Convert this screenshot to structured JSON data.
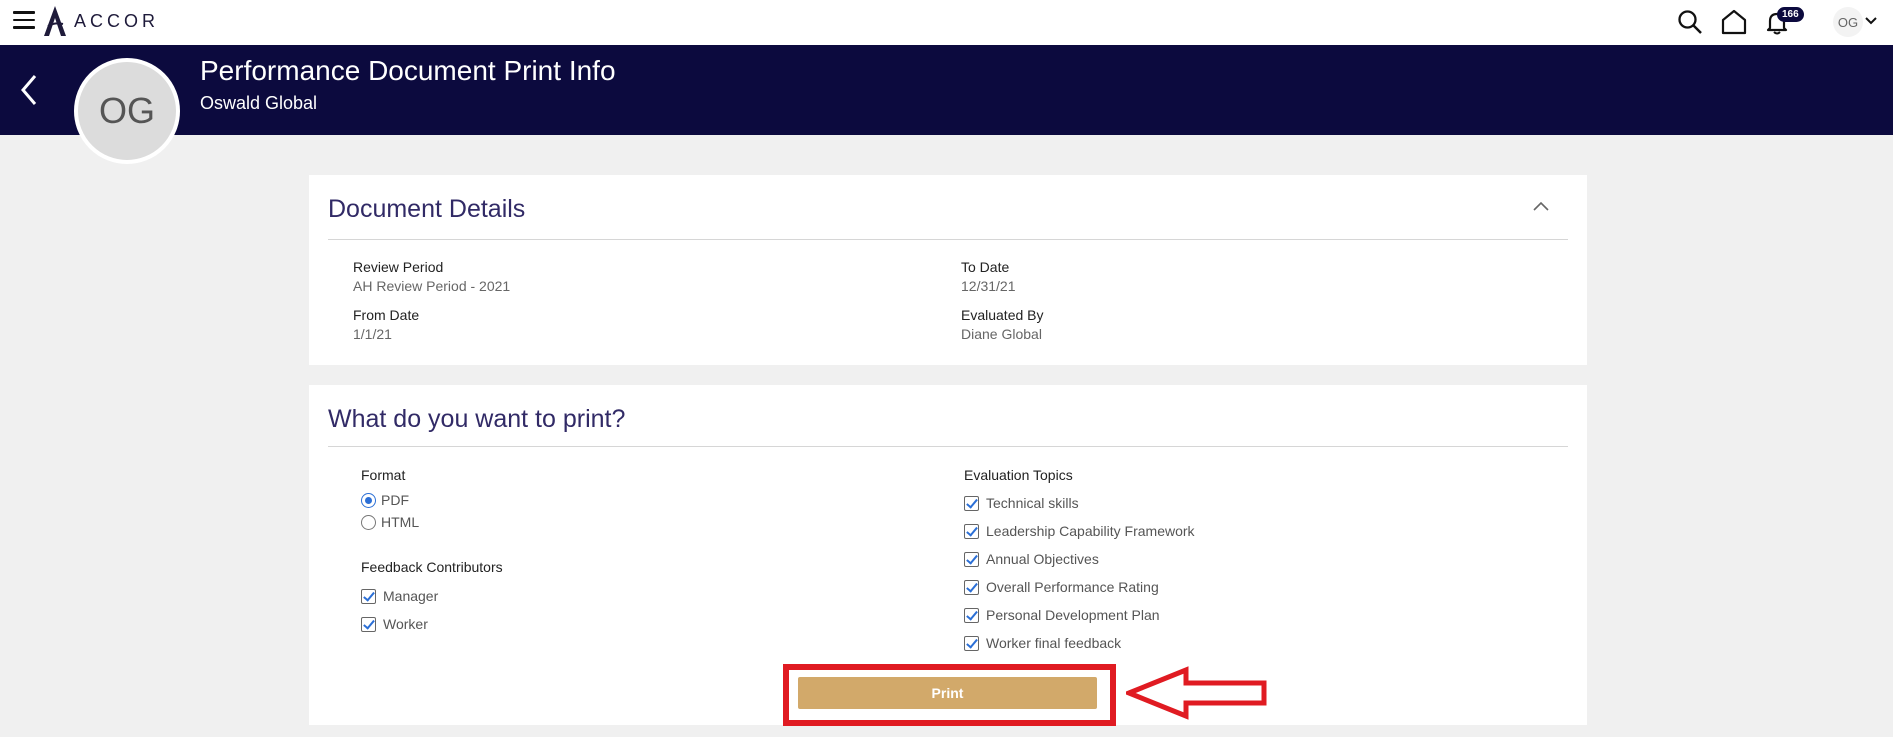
{
  "topbar": {
    "brand": "ACCOR",
    "notification_count": "166",
    "user_initials": "OG",
    "icons": [
      "menu-icon",
      "search-icon",
      "home-icon",
      "bell-icon",
      "chevron-down-icon"
    ]
  },
  "header": {
    "title": "Performance Document Print Info",
    "subtitle": "Oswald Global",
    "avatar_initials": "OG"
  },
  "document_details": {
    "title": "Document Details",
    "fields": {
      "review_period_label": "Review Period",
      "review_period_value": "AH Review Period - 2021",
      "to_date_label": "To Date",
      "to_date_value": "12/31/21",
      "from_date_label": "From Date",
      "from_date_value": "1/1/21",
      "evaluated_by_label": "Evaluated By",
      "evaluated_by_value": "Diane Global"
    }
  },
  "print_options": {
    "title": "What do you want to print?",
    "format_label": "Format",
    "format_options": [
      "PDF",
      "HTML"
    ],
    "format_selected": "PDF",
    "contributors_label": "Feedback Contributors",
    "contributors": [
      "Manager",
      "Worker"
    ],
    "topics_label": "Evaluation Topics",
    "topics": [
      "Technical skills",
      "Leadership Capability Framework",
      "Annual Objectives",
      "Overall Performance Rating",
      "Personal Development Plan",
      "Worker final feedback"
    ],
    "print_label": "Print"
  },
  "colors": {
    "header_bg": "#0c0a3e",
    "accent_title": "#312a66",
    "print_button": "#d2a96a",
    "annotation_red": "#e01b22"
  }
}
